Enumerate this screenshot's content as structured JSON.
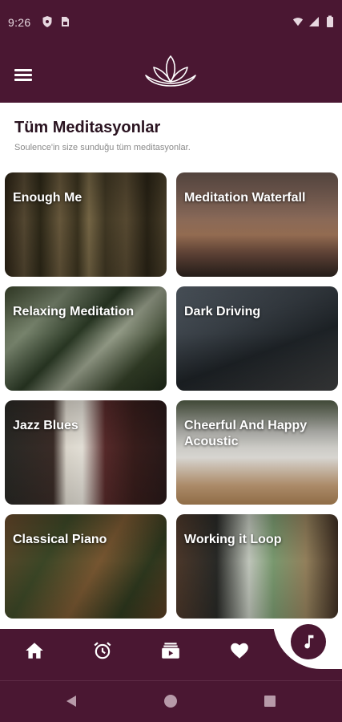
{
  "status_bar": {
    "time": "9:26",
    "icons": [
      "shield-icon",
      "sim-card-icon",
      "wifi-icon",
      "signal-icon",
      "battery-icon"
    ]
  },
  "app_bar": {
    "icons": [
      "menu-icon",
      "lotus-logo-icon"
    ]
  },
  "page": {
    "title": "Tüm Meditasyonlar",
    "subtitle": "Soulence'in size sunduğu tüm meditasyonlar."
  },
  "cards": [
    {
      "title": "Enough Me"
    },
    {
      "title": "Meditation Waterfall"
    },
    {
      "title": "Relaxing Meditation"
    },
    {
      "title": "Dark Driving"
    },
    {
      "title": "Jazz Blues"
    },
    {
      "title": "Cheerful And Happy Acoustic"
    },
    {
      "title": "Classical Piano"
    },
    {
      "title": "Working it Loop"
    }
  ],
  "bottom_nav": {
    "items": [
      "home-icon",
      "alarm-clock-icon",
      "playlist-icon",
      "heart-icon"
    ],
    "fab_icon": "music-note-icon"
  },
  "system_nav": {
    "items": [
      "back-icon",
      "home-circle-icon",
      "recents-icon"
    ]
  },
  "colors": {
    "primary": "#4a1732",
    "background": "#ffffff",
    "card_text": "#ffffff"
  }
}
